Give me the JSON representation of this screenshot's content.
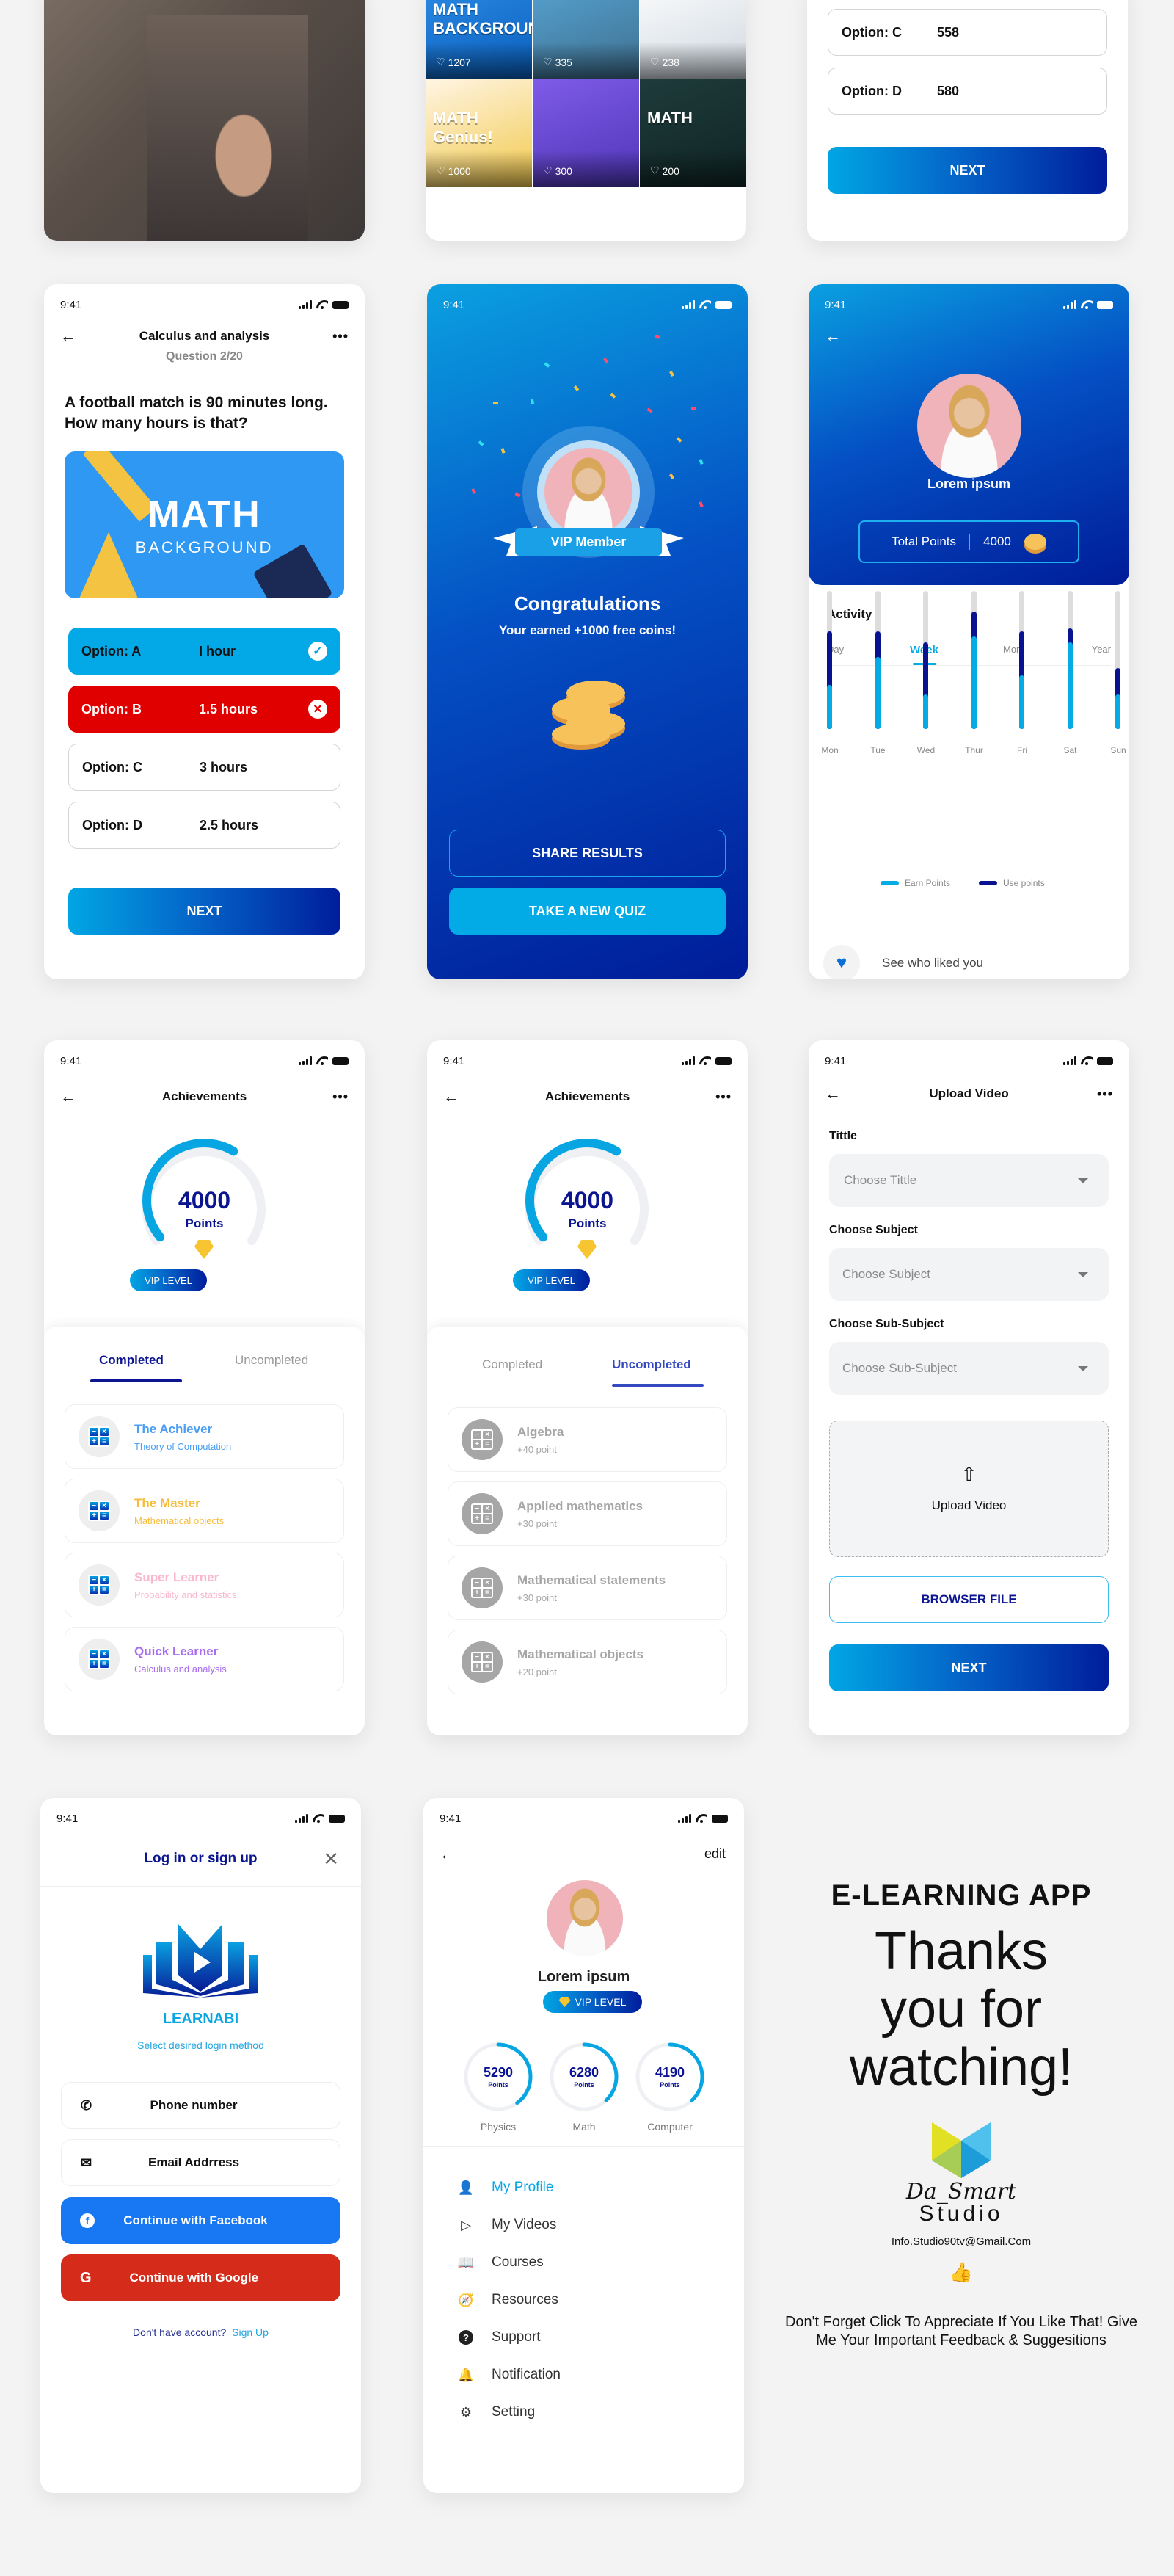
{
  "status_time": "9:41",
  "top_row": {
    "gallery_likes": [
      "1207",
      "335",
      "238",
      "1000",
      "300",
      "200"
    ],
    "gallery_titles": [
      "MATH BACKGROUND",
      "",
      "",
      "MATH Genius!",
      "",
      "MATH"
    ],
    "quiz_options": [
      {
        "label": "Option: C",
        "value": "558"
      },
      {
        "label": "Option: D",
        "value": "580"
      }
    ],
    "next_label": "NEXT"
  },
  "quiz": {
    "title": "Calculus and analysis",
    "subtitle": "Question 2/20",
    "question": "A football match is 90 minutes long. How many hours is that?",
    "banner_title": "MATH",
    "banner_subtitle": "BACKGROUND",
    "options": [
      {
        "label": "Option: A",
        "value": "I hour",
        "state": "correct"
      },
      {
        "label": "Option: B",
        "value": "1.5 hours",
        "state": "wrong"
      },
      {
        "label": "Option: C",
        "value": "3 hours",
        "state": "none"
      },
      {
        "label": "Option: D",
        "value": "2.5 hours",
        "state": "none"
      }
    ],
    "next_label": "NEXT",
    "colors": {
      "correct": "#03a9e6",
      "wrong": "#e10000"
    }
  },
  "congrats": {
    "ribbon": "VIP Member",
    "title": "Congratulations",
    "subtitle": "Your earned +1000 free coins!",
    "share_label": "SHARE RESULTS",
    "new_quiz_label": "TAKE A NEW QUIZ"
  },
  "points_profile": {
    "name": "Lorem ipsum",
    "total_label": "Total Points",
    "total_value": "4000",
    "activity_title": "Activity",
    "tabs": [
      "Day",
      "Week",
      "Mon",
      "Year"
    ],
    "active_tab": "Week",
    "see_liked": "See who liked you"
  },
  "chart_data": {
    "type": "bar",
    "title": "Activity",
    "categories": [
      "Mon",
      "Tue",
      "Wed",
      "Thur",
      "Fri",
      "Sat",
      "Sun"
    ],
    "series": [
      {
        "name": "Earn Points",
        "color": "#05abe5",
        "values": [
          32,
          52,
          25,
          67,
          39,
          63,
          25
        ]
      },
      {
        "name": "Use points",
        "color": "#0a138f",
        "values": [
          39,
          19,
          38,
          18,
          32,
          10,
          19
        ]
      }
    ],
    "ylim": [
      0,
      100
    ],
    "legend": "bottom",
    "grid": false
  },
  "achievements": {
    "title": "Achievements",
    "points": "4000",
    "points_label": "Points",
    "progress_fraction": 0.62,
    "vip_label": "VIP LEVEL",
    "tabs": [
      "Completed",
      "Uncompleted"
    ],
    "completed": [
      {
        "title": "The Achiever",
        "subtitle": "Theory of Computation",
        "color": "#4a9ff5"
      },
      {
        "title": "The Master",
        "subtitle": "Mathematical objects",
        "color": "#f7bb3b"
      },
      {
        "title": "Super Learner",
        "subtitle": "Probability and statistics",
        "color": "#f9b8cf"
      },
      {
        "title": "Quick Learner",
        "subtitle": "Calculus and analysis",
        "color": "#a86ef0"
      }
    ],
    "uncompleted": [
      {
        "title": "Algebra",
        "subtitle": "+40 point"
      },
      {
        "title": "Applied mathematics",
        "subtitle": "+30 point"
      },
      {
        "title": "Mathematical statements",
        "subtitle": "+30 point"
      },
      {
        "title": "Mathematical objects",
        "subtitle": "+20 point"
      }
    ]
  },
  "upload": {
    "title": "Upload Video",
    "fields": [
      {
        "label": "Tittle",
        "placeholder": "Choose Tittle"
      },
      {
        "label": "Choose Subject",
        "placeholder": "Choose Subject"
      },
      {
        "label": "Choose Sub-Subject",
        "placeholder": "Choose Sub-Subject"
      }
    ],
    "drop_label": "Upload Video",
    "browse_label": "BROWSER FILE",
    "next_label": "NEXT"
  },
  "login": {
    "title": "Log in or sign up",
    "brand": "LEARNABI",
    "tagline": "Select desired login method",
    "phone_label": "Phone number",
    "email_label": "Email Addrress",
    "facebook_label": "Continue with Facebook",
    "google_label": "Continue with Google",
    "no_account": "Don't have account?",
    "signup_link": "Sign Up",
    "colors": {
      "facebook": "#1877f2",
      "google": "#d52b1a"
    }
  },
  "profile": {
    "edit_label": "edit",
    "name": "Lorem ipsum",
    "vip_label": "VIP LEVEL",
    "stats": [
      {
        "value": "5290",
        "unit": "Points",
        "label": "Physics",
        "fraction": 0.4
      },
      {
        "value": "6280",
        "unit": "Points",
        "label": "Math",
        "fraction": 0.38
      },
      {
        "value": "4190",
        "unit": "Points",
        "label": "Computer",
        "fraction": 0.38
      }
    ],
    "menu": [
      {
        "label": "My Profile",
        "icon": "user-icon",
        "active": true
      },
      {
        "label": "My Videos",
        "icon": "play-icon",
        "active": false
      },
      {
        "label": "Courses",
        "icon": "book-icon",
        "active": false
      },
      {
        "label": "Resources",
        "icon": "compass-icon",
        "active": false
      },
      {
        "label": "Support",
        "icon": "help-icon",
        "active": false
      },
      {
        "label": "Notification",
        "icon": "bell-icon",
        "active": false
      },
      {
        "label": "Setting",
        "icon": "gear-icon",
        "active": false
      }
    ]
  },
  "promo": {
    "app_title": "E-LEARNING APP",
    "thanks": "Thanks you for watching!",
    "studio_script": "Da_Smart",
    "studio_name": "Studio",
    "email": "Info.Studio90tv@Gmail.Com",
    "footer": "Don't Forget Click To Appreciate If You Like That! Give Me Your Important Feedback & Suggesitions"
  }
}
